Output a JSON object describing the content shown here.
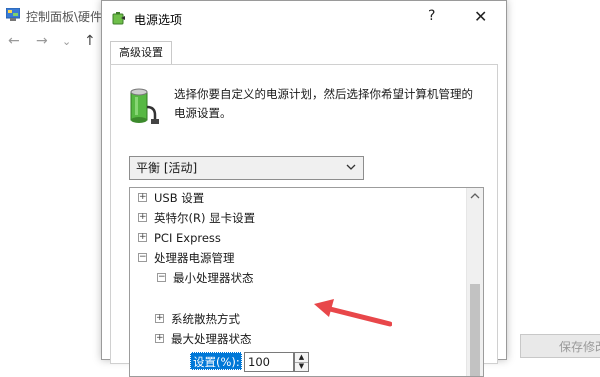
{
  "background_window": {
    "title": "控制面板\\硬件",
    "nav": {
      "back": "←",
      "forward": "→",
      "dropdown": "⌄",
      "up": "↑"
    },
    "bottom_button_label": "保存修改"
  },
  "dialog": {
    "title": "电源选项",
    "help": "?",
    "close": "✕",
    "tab": "高级设置",
    "description": "选择你要自定义的电源计划，然后选择你希望计算机管理的电源设置。",
    "plan_select_value": "平衡 [活动]",
    "tree": [
      {
        "label": "USB 设置",
        "expander": "+"
      },
      {
        "label": "英特尔(R) 显卡设置",
        "expander": "+"
      },
      {
        "label": "PCI Express",
        "expander": "+"
      },
      {
        "label": "处理器电源管理",
        "expander": "−"
      },
      {
        "label": "最小处理器状态",
        "expander": "−"
      },
      {
        "label": "系统散热方式",
        "expander": "+"
      },
      {
        "label": "最大处理器状态",
        "expander": "+"
      }
    ],
    "setting_label": "设置(%):",
    "setting_value": "100",
    "spin_up": "▲",
    "spin_down": "▼"
  },
  "colors": {
    "selection": "#0078d7",
    "arrow": "#e8474a"
  }
}
